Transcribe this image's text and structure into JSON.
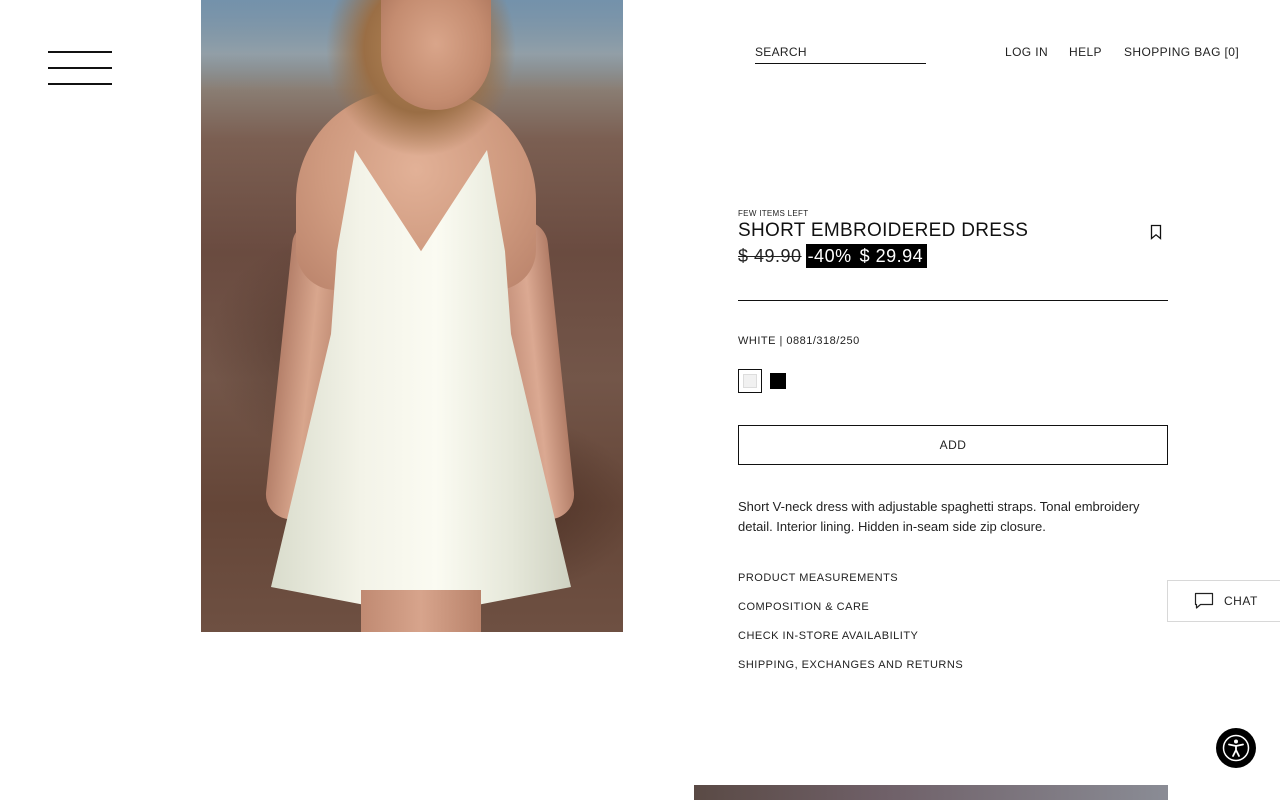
{
  "header": {
    "search_label": "SEARCH",
    "login_label": "LOG IN",
    "help_label": "HELP",
    "bag_label": "SHOPPING BAG [0]"
  },
  "product": {
    "stock_note": "FEW ITEMS LEFT",
    "title": "SHORT EMBROIDERED DRESS",
    "price_old": "$ 49.90",
    "discount": "-40%",
    "price_new": "$ 29.94",
    "color_ref": "WHITE | 0881/318/250",
    "colors": [
      {
        "name": "white",
        "hex": "#f1f1f1",
        "selected": true
      },
      {
        "name": "black",
        "hex": "#000000",
        "selected": false
      }
    ],
    "add_label": "ADD",
    "description": "Short V-neck dress with adjustable spaghetti straps. Tonal embroidery detail. Interior lining. Hidden in-seam side zip closure.",
    "info_links": [
      "PRODUCT MEASUREMENTS",
      "COMPOSITION & CARE",
      "CHECK IN-STORE AVAILABILITY",
      "SHIPPING, EXCHANGES AND RETURNS"
    ]
  },
  "chat": {
    "label": "CHAT"
  },
  "icons": {
    "menu": "hamburger-menu-icon",
    "bookmark": "bookmark-icon",
    "chat": "chat-bubble-icon",
    "accessibility": "accessibility-icon"
  }
}
